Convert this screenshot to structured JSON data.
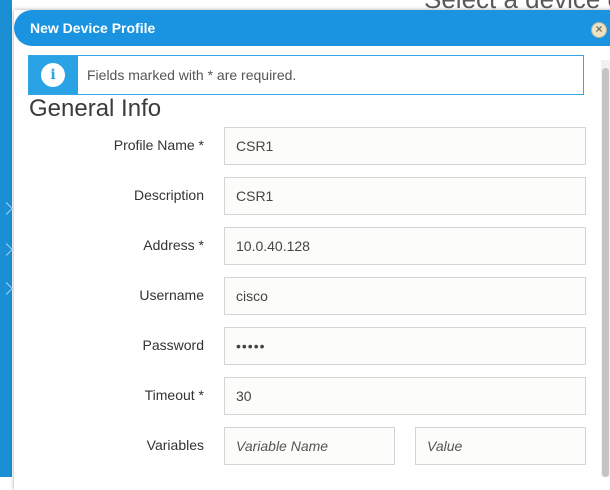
{
  "background": {
    "heading": "Select a device o"
  },
  "modal": {
    "title": "New Device Profile",
    "close_icon": "x-icon"
  },
  "notice": {
    "icon": "info-icon",
    "icon_glyph": "i",
    "text": "Fields marked with * are required."
  },
  "section": {
    "title": "General Info"
  },
  "form": {
    "profile_name": {
      "label": "Profile Name *",
      "value": "CSR1"
    },
    "description": {
      "label": "Description",
      "value": "CSR1"
    },
    "address": {
      "label": "Address *",
      "value": "10.0.40.128"
    },
    "username": {
      "label": "Username",
      "value": "cisco"
    },
    "password": {
      "label": "Password",
      "value": "•••••"
    },
    "timeout": {
      "label": "Timeout *",
      "value": "30"
    },
    "variables": {
      "label": "Variables",
      "name_placeholder": "Variable Name",
      "value_placeholder": "Value"
    }
  },
  "colors": {
    "header_blue": "#1a93e0",
    "info_blue": "#2aa3e6",
    "sidebar_blue": "#1a8fd4"
  }
}
